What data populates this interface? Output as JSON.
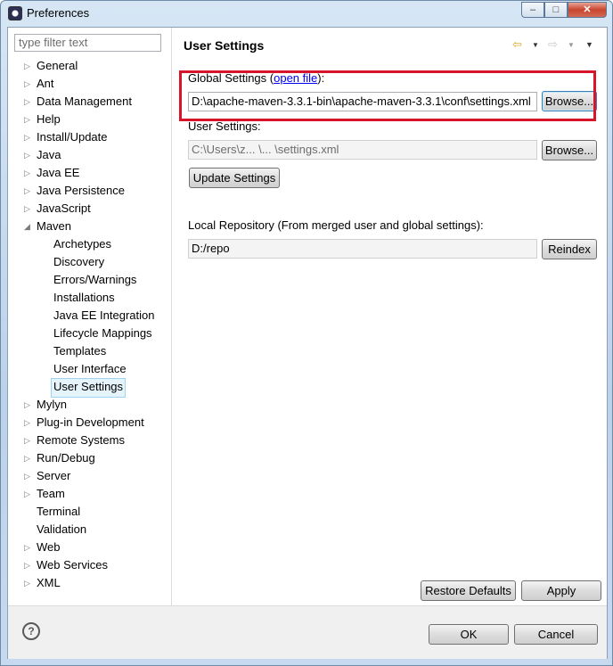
{
  "window": {
    "title": "Preferences",
    "caption_min": "–",
    "caption_max": "□",
    "caption_close": "✕"
  },
  "filter": {
    "placeholder": "type filter text"
  },
  "tree": {
    "items": [
      {
        "label": "General",
        "expandable": true
      },
      {
        "label": "Ant",
        "expandable": true
      },
      {
        "label": "Data Management",
        "expandable": true
      },
      {
        "label": "Help",
        "expandable": true
      },
      {
        "label": "Install/Update",
        "expandable": true
      },
      {
        "label": "Java",
        "expandable": true
      },
      {
        "label": "Java EE",
        "expandable": true
      },
      {
        "label": "Java Persistence",
        "expandable": true
      },
      {
        "label": "JavaScript",
        "expandable": true
      },
      {
        "label": "Maven",
        "expanded": true
      },
      {
        "label": "Archetypes",
        "child": true
      },
      {
        "label": "Discovery",
        "child": true
      },
      {
        "label": "Errors/Warnings",
        "child": true
      },
      {
        "label": "Installations",
        "child": true
      },
      {
        "label": "Java EE Integration",
        "child": true
      },
      {
        "label": "Lifecycle Mappings",
        "child": true
      },
      {
        "label": "Templates",
        "child": true
      },
      {
        "label": "User Interface",
        "child": true
      },
      {
        "label": "User Settings",
        "child": true,
        "selected": true
      },
      {
        "label": "Mylyn",
        "expandable": true
      },
      {
        "label": "Plug-in Development",
        "expandable": true
      },
      {
        "label": "Remote Systems",
        "expandable": true
      },
      {
        "label": "Run/Debug",
        "expandable": true
      },
      {
        "label": "Server",
        "expandable": true
      },
      {
        "label": "Team",
        "expandable": true
      },
      {
        "label": "Terminal"
      },
      {
        "label": "Validation"
      },
      {
        "label": "Web",
        "expandable": true
      },
      {
        "label": "Web Services",
        "expandable": true
      },
      {
        "label": "XML",
        "expandable": true
      }
    ]
  },
  "page": {
    "title": "User Settings",
    "global_label": "Global Settings (",
    "global_link": "open file",
    "global_label_end": "):",
    "global_value": "D:\\apache-maven-3.3.1-bin\\apache-maven-3.3.1\\conf\\settings.xml",
    "browse_label": "Browse...",
    "user_label": "User Settings:",
    "user_value": "C:\\Users\\z... \\... \\settings.xml",
    "update_label": "Update Settings",
    "local_repo_label": "Local Repository (From merged user and global settings):",
    "local_repo_value": "D:/repo",
    "reindex_label": "Reindex",
    "restore_label": "Restore Defaults",
    "apply_label": "Apply"
  },
  "nav": {
    "back_icon": "back-arrow-icon",
    "forward_icon": "forward-arrow-icon",
    "menu_icon": "view-menu-icon"
  },
  "footer": {
    "help_icon": "help-icon",
    "help_glyph": "?",
    "ok_label": "OK",
    "cancel_label": "Cancel"
  },
  "colors": {
    "highlight_border": "#d8142a",
    "accent": "#0000ee"
  }
}
